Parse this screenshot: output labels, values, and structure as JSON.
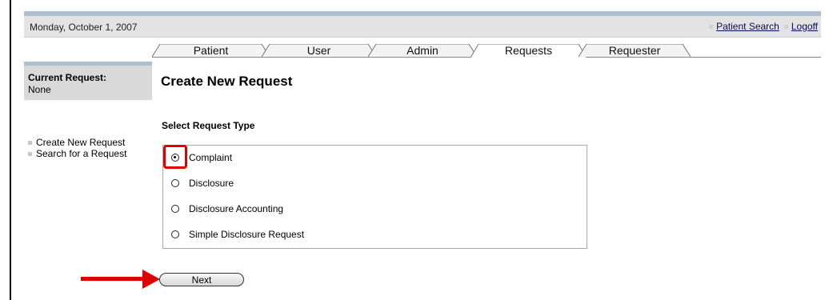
{
  "header": {
    "date": "Monday, October 1, 2007",
    "links": [
      {
        "label": "Patient Search"
      },
      {
        "label": "Logoff"
      }
    ]
  },
  "tabs": [
    {
      "label": "Patient",
      "active": false
    },
    {
      "label": "User",
      "active": false
    },
    {
      "label": "Admin",
      "active": false
    },
    {
      "label": "Requests",
      "active": true
    },
    {
      "label": "Requester",
      "active": false
    }
  ],
  "sidebar": {
    "current_title": "Current Request:",
    "current_value": "None",
    "items": [
      {
        "label": "Create New Request"
      },
      {
        "label": "Search for a Request"
      }
    ]
  },
  "main": {
    "title": "Create New Request",
    "section_label": "Select Request Type",
    "options": [
      {
        "label": "Complaint",
        "selected": true
      },
      {
        "label": "Disclosure",
        "selected": false
      },
      {
        "label": "Disclosure Accounting",
        "selected": false
      },
      {
        "label": "Simple Disclosure Request",
        "selected": false
      }
    ],
    "next_label": "Next"
  },
  "colors": {
    "header_accent": "#aebfd2",
    "header_bg": "#e3e3e3",
    "annotation_red": "#e00000"
  }
}
